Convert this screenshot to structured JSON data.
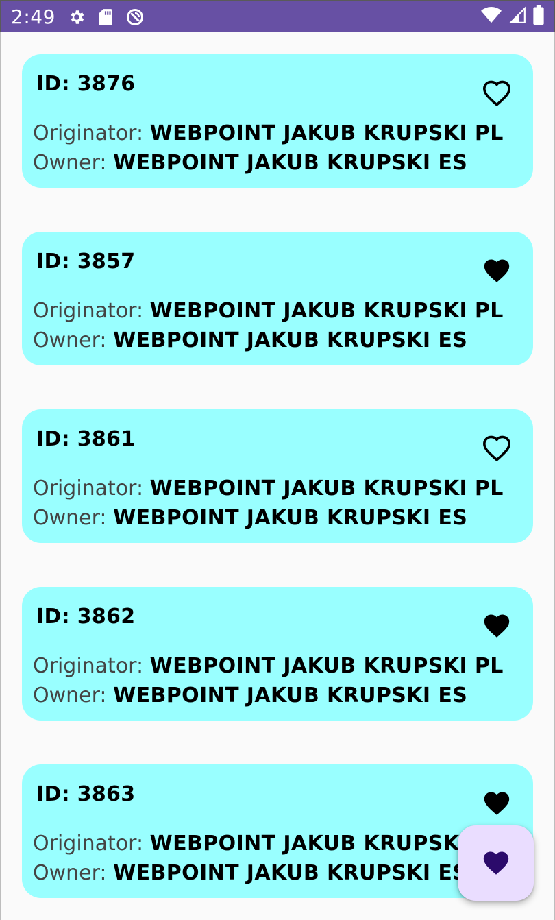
{
  "status_bar": {
    "time": "2:49",
    "left_icons": [
      "gear-icon",
      "sd-card-icon",
      "sync-off-icon"
    ],
    "right_icons": [
      "wifi-icon",
      "cell-signal-icon",
      "battery-icon"
    ]
  },
  "cards": [
    {
      "id_text": "ID: 3876",
      "originator_label": "Originator: ",
      "originator_value": "WEBPOINT JAKUB KRUPSKI PL",
      "owner_label": "Owner: ",
      "owner_value": "WEBPOINT JAKUB KRUPSKI ES",
      "favorite": false
    },
    {
      "id_text": "ID: 3857",
      "originator_label": "Originator: ",
      "originator_value": "WEBPOINT JAKUB KRUPSKI PL",
      "owner_label": "Owner: ",
      "owner_value": "WEBPOINT JAKUB KRUPSKI ES",
      "favorite": true
    },
    {
      "id_text": "ID: 3861",
      "originator_label": "Originator: ",
      "originator_value": "WEBPOINT JAKUB KRUPSKI PL",
      "owner_label": "Owner: ",
      "owner_value": "WEBPOINT JAKUB KRUPSKI ES",
      "favorite": false
    },
    {
      "id_text": "ID: 3862",
      "originator_label": "Originator: ",
      "originator_value": "WEBPOINT JAKUB KRUPSKI PL",
      "owner_label": "Owner: ",
      "owner_value": "WEBPOINT JAKUB KRUPSKI ES",
      "favorite": true
    },
    {
      "id_text": "ID: 3863",
      "originator_label": "Originator: ",
      "originator_value": "WEBPOINT JAKUB KRUPSKI PL",
      "owner_label": "Owner: ",
      "owner_value": "WEBPOINT JAKUB KRUPSKI ES",
      "favorite": true
    }
  ],
  "fab": {
    "icon": "heart-filled-icon"
  },
  "colors": {
    "status_bar": "#6750a4",
    "card_background": "#99ffff",
    "page_background": "#fafafa",
    "fab_background": "#eaddff",
    "fab_icon": "#2b0a6b"
  }
}
